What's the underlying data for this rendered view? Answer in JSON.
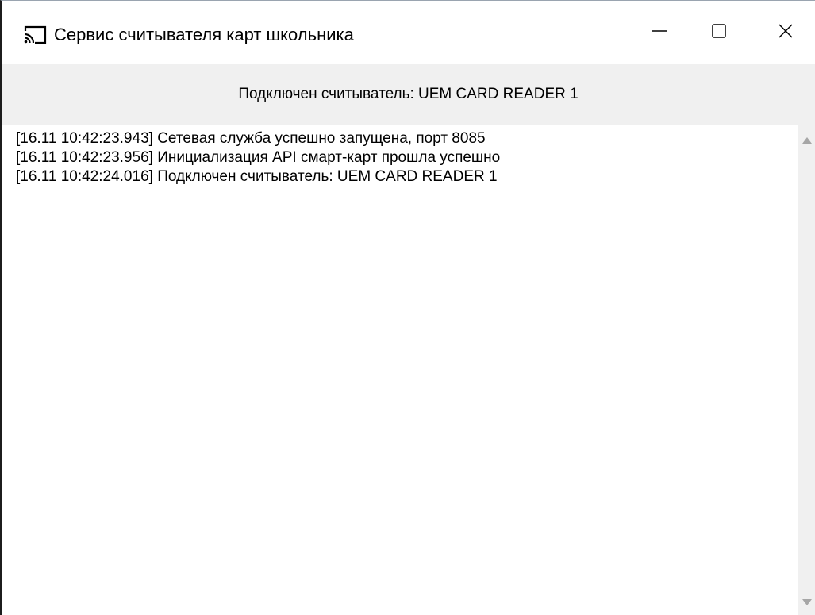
{
  "window": {
    "title": "Сервис считывателя карт школьника",
    "app_icon": "cast-icon",
    "controls": {
      "minimize_icon": "minimize-icon",
      "maximize_icon": "maximize-icon",
      "close_icon": "close-icon"
    }
  },
  "status": {
    "text": "Подключен считыватель: UEM CARD READER 1"
  },
  "log": {
    "lines": [
      "[16.11 10:42:23.943] Сетевая служба успешно запущена, порт 8085",
      "[16.11 10:42:23.956] Инициализация API смарт-карт прошла успешно",
      "[16.11 10:42:24.016] Подключен считыватель: UEM CARD READER 1"
    ]
  },
  "scrollbar": {
    "up_icon": "scroll-up-arrow-icon",
    "down_icon": "scroll-down-arrow-icon"
  }
}
